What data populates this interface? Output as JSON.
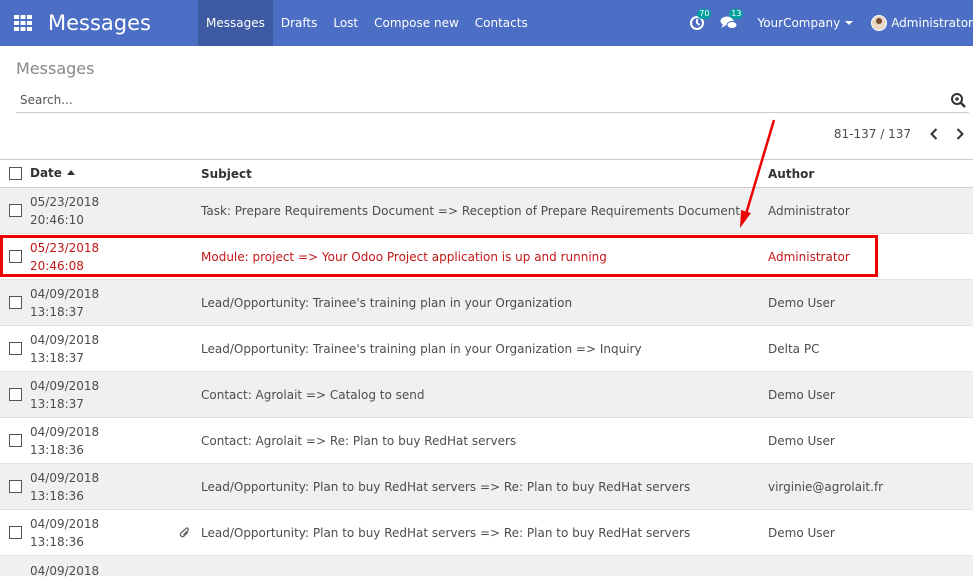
{
  "app": {
    "title": "Messages"
  },
  "menu": [
    {
      "label": "Messages",
      "active": true
    },
    {
      "label": "Drafts"
    },
    {
      "label": "Lost"
    },
    {
      "label": "Compose new"
    },
    {
      "label": "Contacts"
    }
  ],
  "systray": {
    "activity_count": "70",
    "messages_count": "13",
    "company": "YourCompany",
    "user": "Administrator"
  },
  "breadcrumb": "Messages",
  "search": {
    "placeholder": "Search..."
  },
  "pager": {
    "value": "81-137 / 137"
  },
  "table": {
    "headers": {
      "date": "Date",
      "subject": "Subject",
      "author": "Author"
    },
    "rows": [
      {
        "date": "05/23/2018",
        "time": "20:46:10",
        "subject": "Task: Prepare Requirements Document => Reception of Prepare Requirements Document",
        "author": "Administrator"
      },
      {
        "date": "05/23/2018",
        "time": "20:46:08",
        "subject": "Module: project => Your Odoo Project application is up and running",
        "author": "Administrator",
        "highlighted": true
      },
      {
        "date": "04/09/2018",
        "time": "13:18:37",
        "subject": "Lead/Opportunity: Trainee's training plan in your Organization",
        "author": "Demo User"
      },
      {
        "date": "04/09/2018",
        "time": "13:18:37",
        "subject": "Lead/Opportunity: Trainee's training plan in your Organization => Inquiry",
        "author": "Delta PC"
      },
      {
        "date": "04/09/2018",
        "time": "13:18:37",
        "subject": "Contact: Agrolait => Catalog to send",
        "author": "Demo User"
      },
      {
        "date": "04/09/2018",
        "time": "13:18:36",
        "subject": "Contact: Agrolait => Re: Plan to buy RedHat servers",
        "author": "Demo User"
      },
      {
        "date": "04/09/2018",
        "time": "13:18:36",
        "subject": "Lead/Opportunity: Plan to buy RedHat servers => Re: Plan to buy RedHat servers",
        "author": "virginie@agrolait.fr"
      },
      {
        "date": "04/09/2018",
        "time": "13:18:36",
        "subject": "Lead/Opportunity: Plan to buy RedHat servers => Re: Plan to buy RedHat servers",
        "author": "Demo User",
        "attachment": true
      },
      {
        "date": "04/09/2018"
      }
    ]
  },
  "colors": {
    "navbar": "#4c6ec4",
    "active_menu": "#3d5aa3",
    "badge": "#00a09d",
    "highlight": "#c41717",
    "annotation": "#ee0000"
  },
  "icons": [
    "apps-grid-icon",
    "clock-icon",
    "chat-icon",
    "search-plus-icon",
    "chevron-left-icon",
    "chevron-right-icon",
    "paperclip-icon"
  ]
}
